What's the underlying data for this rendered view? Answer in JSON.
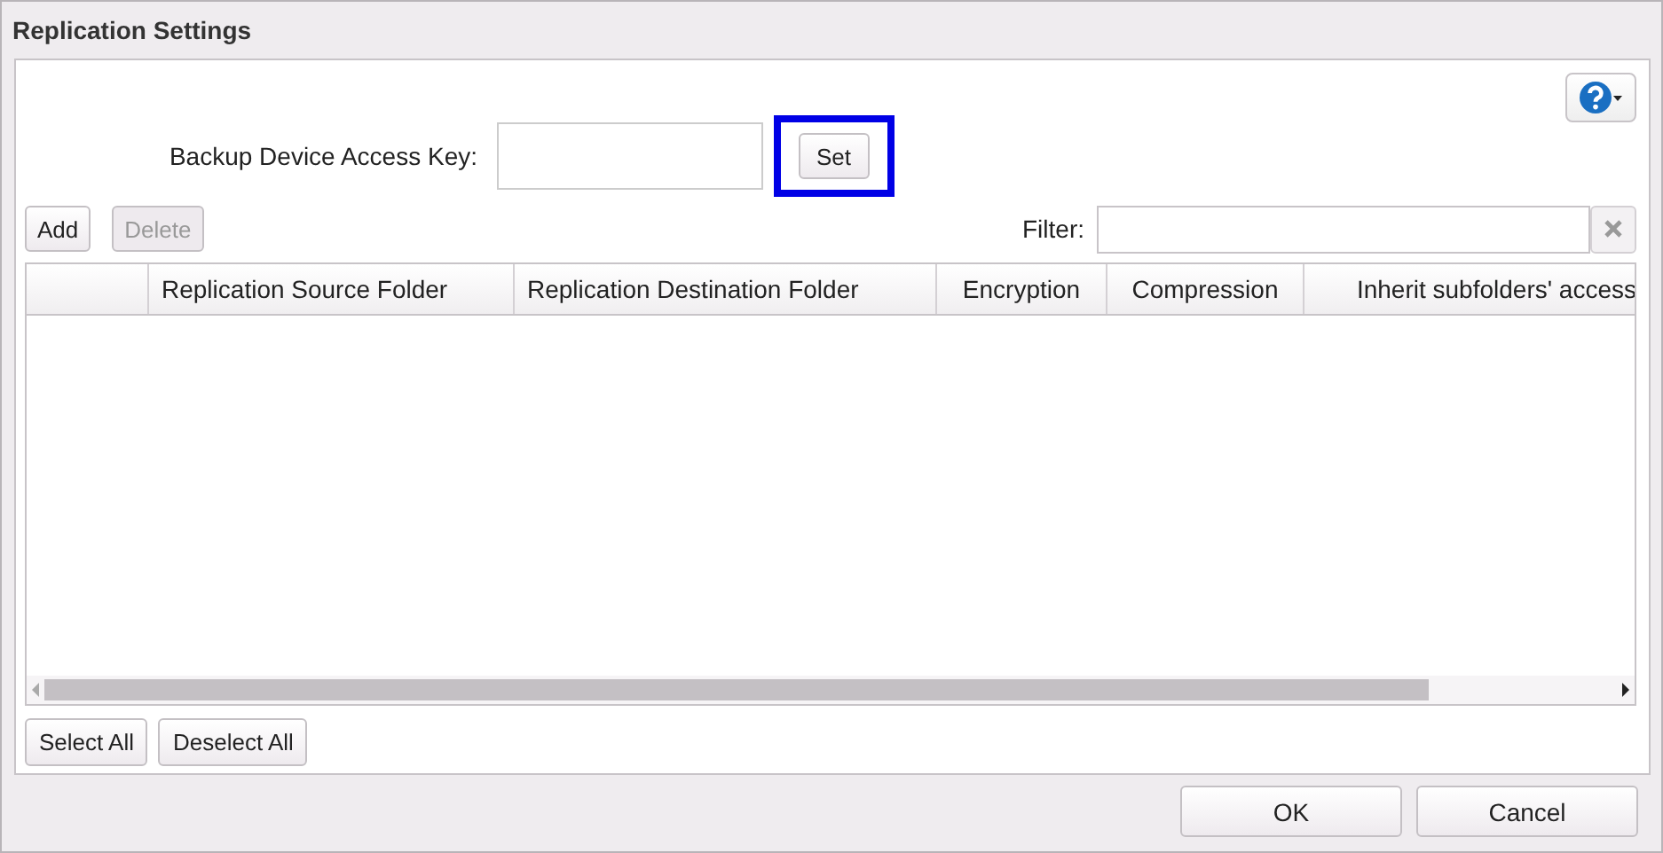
{
  "window": {
    "title": "Replication Settings"
  },
  "access_key": {
    "label": "Backup Device Access Key:",
    "set_button": {
      "label": "Set",
      "highlighted": true
    }
  },
  "toolbar": {
    "buttons": [
      {
        "label": "Add",
        "disabled": false
      },
      {
        "label": "Delete",
        "disabled": true
      }
    ],
    "filter_label": "Filter:"
  },
  "table": {
    "columns": [
      "Replication Source Folder",
      "Replication Destination Folder",
      "Encryption",
      "Compression",
      "Inherit subfolders' access"
    ]
  },
  "selection_buttons": [
    "Select All",
    "Deselect All"
  ],
  "dialog_buttons": [
    "OK",
    "Cancel"
  ]
}
